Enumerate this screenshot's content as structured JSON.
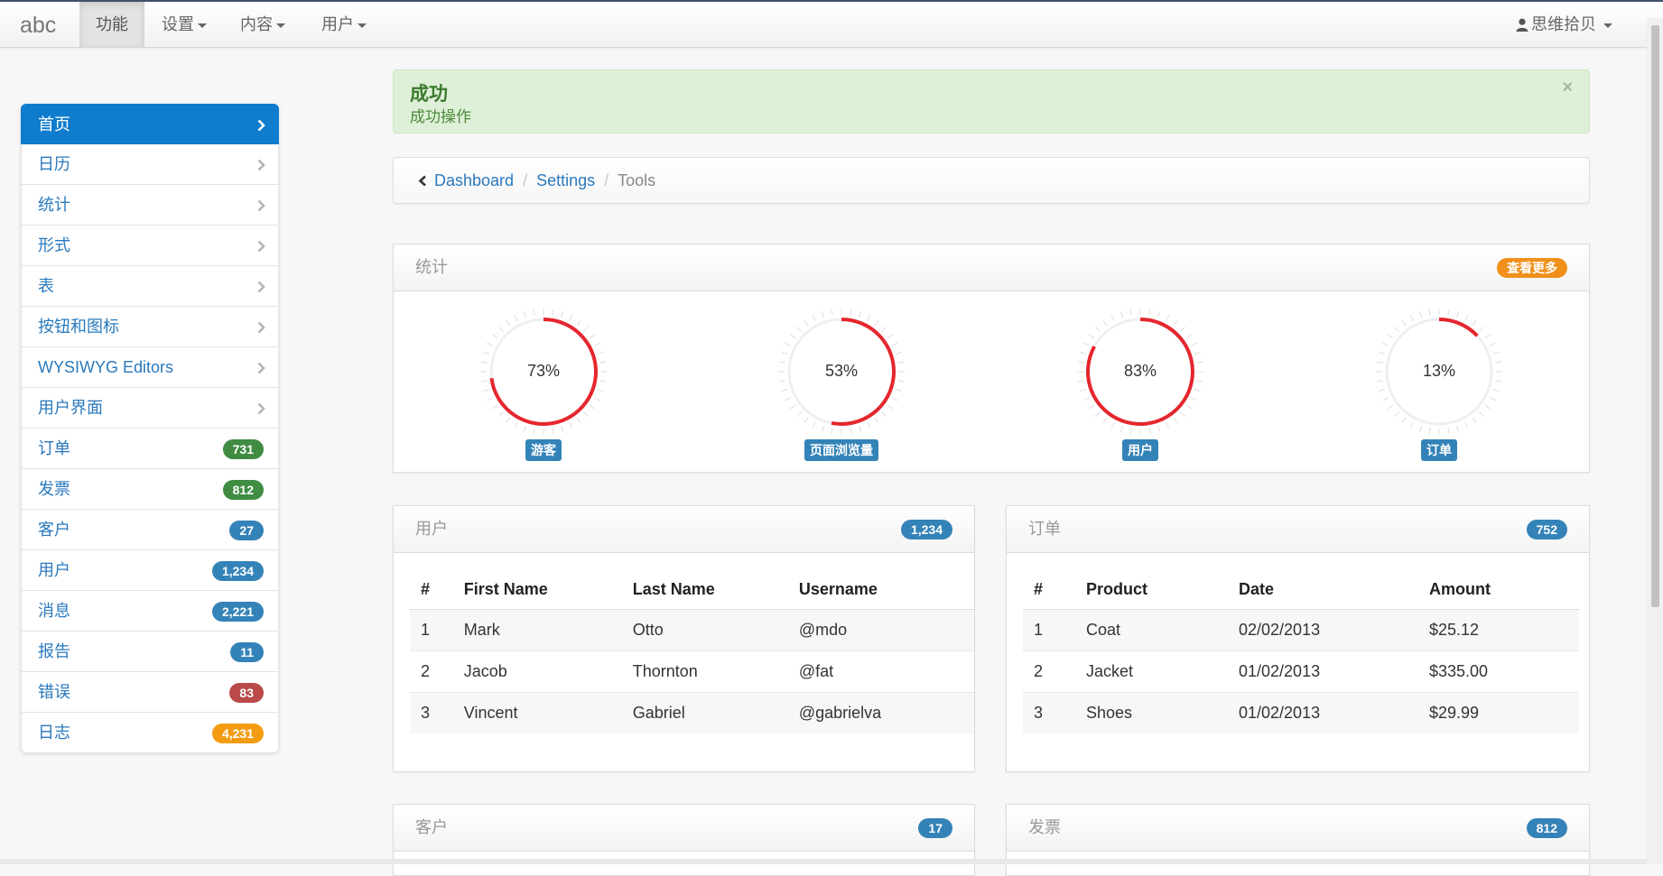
{
  "app": {
    "brand": "abc",
    "nav": [
      {
        "label": "功能"
      },
      {
        "label": "设置"
      },
      {
        "label": "内容"
      },
      {
        "label": "用户"
      }
    ],
    "user": "思维拾贝"
  },
  "sidebar": {
    "items": [
      {
        "label": "首页",
        "active": true
      },
      {
        "label": "日历"
      },
      {
        "label": "统计"
      },
      {
        "label": "形式"
      },
      {
        "label": "表"
      },
      {
        "label": "按钮和图标"
      },
      {
        "label": "WYSIWYG Editors"
      },
      {
        "label": "用户界面"
      },
      {
        "label": "订单",
        "badge": "731",
        "color": "#3f8c42"
      },
      {
        "label": "发票",
        "badge": "812",
        "color": "#3f8c42"
      },
      {
        "label": "客户",
        "badge": "27",
        "color": "#3483b8"
      },
      {
        "label": "用户",
        "badge": "1,234",
        "color": "#3483b8"
      },
      {
        "label": "消息",
        "badge": "2,221",
        "color": "#3483b8"
      },
      {
        "label": "报告",
        "badge": "11",
        "color": "#3483b8"
      },
      {
        "label": "错误",
        "badge": "83",
        "color": "#b94a48"
      },
      {
        "label": "日志",
        "badge": "4,231",
        "color": "#f39c12"
      }
    ]
  },
  "alert": {
    "title": "成功",
    "message": "成功操作",
    "close": "×"
  },
  "breadcrumb": {
    "items": [
      "Dashboard",
      "Settings",
      "Tools"
    ],
    "separator": "/"
  },
  "stats": {
    "title": "统计",
    "more_label": "查看更多",
    "more_color": "#f0901a",
    "accent": "#e5262e",
    "gauges": [
      {
        "value": 73,
        "text": "73%",
        "label": "游客"
      },
      {
        "value": 53,
        "text": "53%",
        "label": "页面浏览量"
      },
      {
        "value": 83,
        "text": "83%",
        "label": "用户"
      },
      {
        "value": 13,
        "text": "13%",
        "label": "订单"
      }
    ]
  },
  "users_panel": {
    "title": "用户",
    "badge": "1,234",
    "columns": [
      "#",
      "First Name",
      "Last Name",
      "Username"
    ],
    "rows": [
      [
        "1",
        "Mark",
        "Otto",
        "@mdo"
      ],
      [
        "2",
        "Jacob",
        "Thornton",
        "@fat"
      ],
      [
        "3",
        "Vincent",
        "Gabriel",
        "@gabrielva"
      ]
    ]
  },
  "orders_panel": {
    "title": "订单",
    "badge": "752",
    "columns": [
      "#",
      "Product",
      "Date",
      "Amount"
    ],
    "rows": [
      [
        "1",
        "Coat",
        "02/02/2013",
        "$25.12"
      ],
      [
        "2",
        "Jacket",
        "01/02/2013",
        "$335.00"
      ],
      [
        "3",
        "Shoes",
        "01/02/2013",
        "$29.99"
      ]
    ]
  },
  "customers_panel": {
    "title": "客户",
    "badge": "17"
  },
  "invoices_panel": {
    "title": "发票",
    "badge": "812"
  }
}
